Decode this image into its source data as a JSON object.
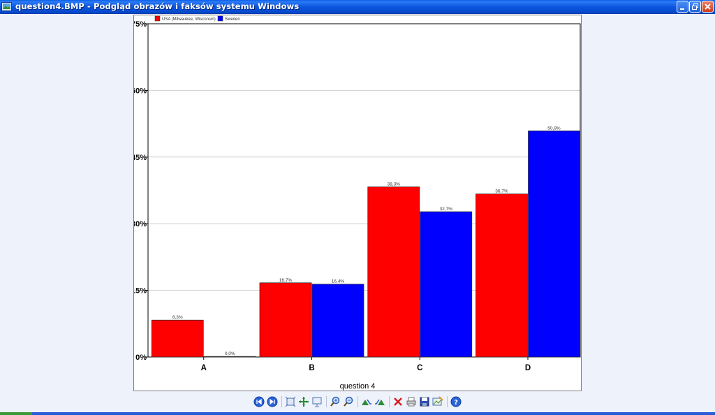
{
  "window": {
    "title": "question4.BMP - Podgląd obrazów i faksów systemu Windows",
    "controls": [
      "minimize",
      "restore",
      "close"
    ]
  },
  "chart_data": {
    "type": "bar",
    "categories": [
      "A",
      "B",
      "C",
      "D"
    ],
    "series": [
      {
        "name": "USA (Milwaukee, Wisconsin)",
        "color": "#ff0000",
        "values": [
          8.3,
          16.7,
          38.3,
          36.7
        ],
        "labels": [
          "8,3%",
          "16,7%",
          "38,3%",
          "36,7%"
        ]
      },
      {
        "name": "Sweden",
        "color": "#0000ff",
        "values": [
          0.0,
          16.4,
          32.7,
          50.9
        ],
        "labels": [
          "0,0%",
          "16,4%",
          "32,7%",
          "50,9%"
        ]
      }
    ],
    "xlabel": "question 4",
    "ylabel": "",
    "ylim": [
      0,
      75
    ],
    "yticks": [
      0,
      15,
      30,
      45,
      60,
      75
    ],
    "ytick_labels": [
      "0%",
      "15%",
      "30%",
      "45%",
      "60%",
      "75%"
    ],
    "grid": true,
    "legend": "top-left"
  },
  "toolbar": {
    "buttons": [
      {
        "name": "previous-image",
        "icon": "prev-icon"
      },
      {
        "name": "next-image",
        "icon": "next-icon"
      },
      {
        "name": "best-fit",
        "icon": "best-fit-icon"
      },
      {
        "name": "actual-size",
        "icon": "actual-size-icon"
      },
      {
        "name": "slideshow",
        "icon": "slideshow-icon"
      },
      {
        "name": "zoom-in",
        "icon": "zoom-in-icon"
      },
      {
        "name": "zoom-out",
        "icon": "zoom-out-icon"
      },
      {
        "name": "rotate-clockwise",
        "icon": "rotate-cw-icon"
      },
      {
        "name": "rotate-counterclockwise",
        "icon": "rotate-ccw-icon"
      },
      {
        "name": "delete",
        "icon": "delete-icon"
      },
      {
        "name": "print",
        "icon": "print-icon"
      },
      {
        "name": "save-as",
        "icon": "save-icon"
      },
      {
        "name": "open-for-editing",
        "icon": "edit-icon"
      },
      {
        "name": "help",
        "icon": "help-icon"
      }
    ]
  }
}
